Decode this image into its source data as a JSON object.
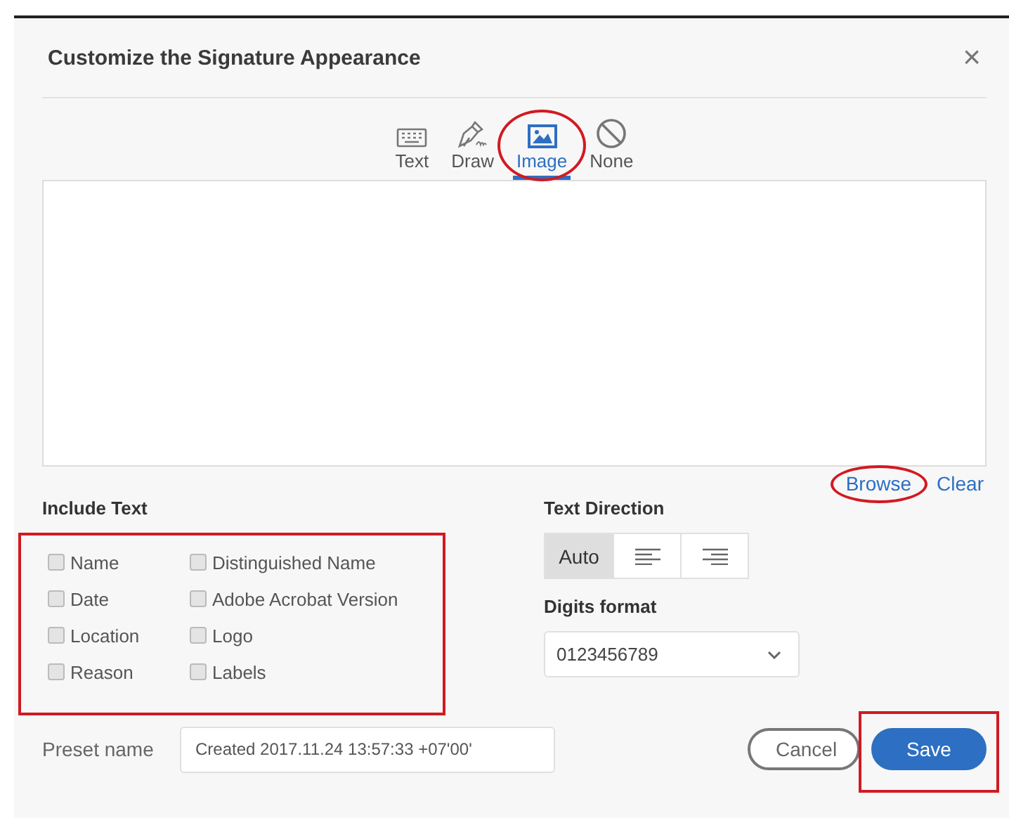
{
  "dialog": {
    "title": "Customize the Signature Appearance",
    "close": "×"
  },
  "tabs": [
    {
      "label": "Text",
      "kind": "keyboard",
      "selected": false
    },
    {
      "label": "Draw",
      "kind": "pen",
      "selected": false
    },
    {
      "label": "Image",
      "kind": "image",
      "selected": true,
      "annotated": true
    },
    {
      "label": "None",
      "kind": "none",
      "selected": false
    }
  ],
  "image_links": [
    {
      "label": "Browse",
      "annotated": true
    },
    {
      "label": "Clear"
    }
  ],
  "include_text": {
    "heading": "Include Text",
    "annotated": true,
    "options": [
      {
        "label": "Name",
        "checked": false
      },
      {
        "label": "Date",
        "checked": false
      },
      {
        "label": "Location",
        "checked": false
      },
      {
        "label": "Reason",
        "checked": false
      },
      {
        "label": "Distinguished Name",
        "checked": false
      },
      {
        "label": "Adobe Acrobat Version",
        "checked": false
      },
      {
        "label": "Logo",
        "checked": false
      },
      {
        "label": "Labels",
        "checked": false
      }
    ]
  },
  "text_direction": {
    "heading": "Text Direction",
    "options": [
      {
        "kind": "text",
        "label": "Auto",
        "selected": true
      },
      {
        "kind": "left",
        "selected": false
      },
      {
        "kind": "right",
        "selected": false
      }
    ]
  },
  "digits_format": {
    "heading": "Digits format",
    "value": "0123456789"
  },
  "preset": {
    "label": "Preset name",
    "value": "Created 2017.11.24 13:57:33 +07'00'"
  },
  "buttons": [
    {
      "label": "Cancel",
      "kind": "secondary"
    },
    {
      "label": "Save",
      "kind": "primary",
      "annotated": true
    }
  ]
}
